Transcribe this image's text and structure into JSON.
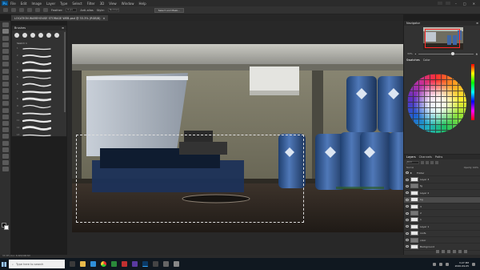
{
  "app": {
    "logo": "Ps",
    "menu": [
      "File",
      "Edit",
      "Image",
      "Layer",
      "Type",
      "Select",
      "Filter",
      "3D",
      "View",
      "Window",
      "Help"
    ]
  },
  "options": {
    "feather_label": "Feather:",
    "feather_value": "0 px",
    "anti_alias": "Anti-alias",
    "style_label": "Style:",
    "style_value": "Normal",
    "select_mask_button": "Select and Mask..."
  },
  "document": {
    "tab_title": "LOCATION WAREHOUSE STORAGE WEB.psd @ 33.3% (RGB/8)"
  },
  "brushes": {
    "title": "Brushes",
    "folder": "Sketch 1",
    "strokes": [
      "1",
      "2",
      "3",
      "4",
      "5",
      "6",
      "7",
      "8",
      "9",
      "10",
      "11",
      "12",
      "13"
    ]
  },
  "navigator": {
    "title": "Navigator",
    "zoom": "33%"
  },
  "swatches": {
    "tabs": [
      "Swatches",
      "Color"
    ]
  },
  "layers": {
    "tabs": [
      "Layers",
      "Channels",
      "Paths"
    ],
    "filter_label": "Kind",
    "blend": "Normal",
    "opacity": "Opacity: 100%",
    "items": [
      {
        "name": "Folder",
        "type": "folder",
        "selected": false
      },
      {
        "name": "Layer 3",
        "type": "layer",
        "selected": false
      },
      {
        "name": "fg",
        "type": "layer",
        "selected": false
      },
      {
        "name": "Layer 2",
        "type": "layer",
        "selected": false
      },
      {
        "name": "bg",
        "type": "layer",
        "selected": true
      },
      {
        "name": "3",
        "type": "layer",
        "selected": false
      },
      {
        "name": "2",
        "type": "layer",
        "selected": false
      },
      {
        "name": "1",
        "type": "layer",
        "selected": false
      },
      {
        "name": "Layer 1",
        "type": "layer",
        "selected": false
      },
      {
        "name": "roofs",
        "type": "layer",
        "selected": false
      },
      {
        "name": "color",
        "type": "layer",
        "selected": false
      },
      {
        "name": "Background",
        "type": "layer",
        "selected": false
      }
    ]
  },
  "status": {
    "text": "33.33%    Doc: 8.92M/168.5M"
  },
  "taskbar": {
    "search_placeholder": "Type here to search",
    "time": "3:27 PM",
    "date": "2020-09-05"
  }
}
